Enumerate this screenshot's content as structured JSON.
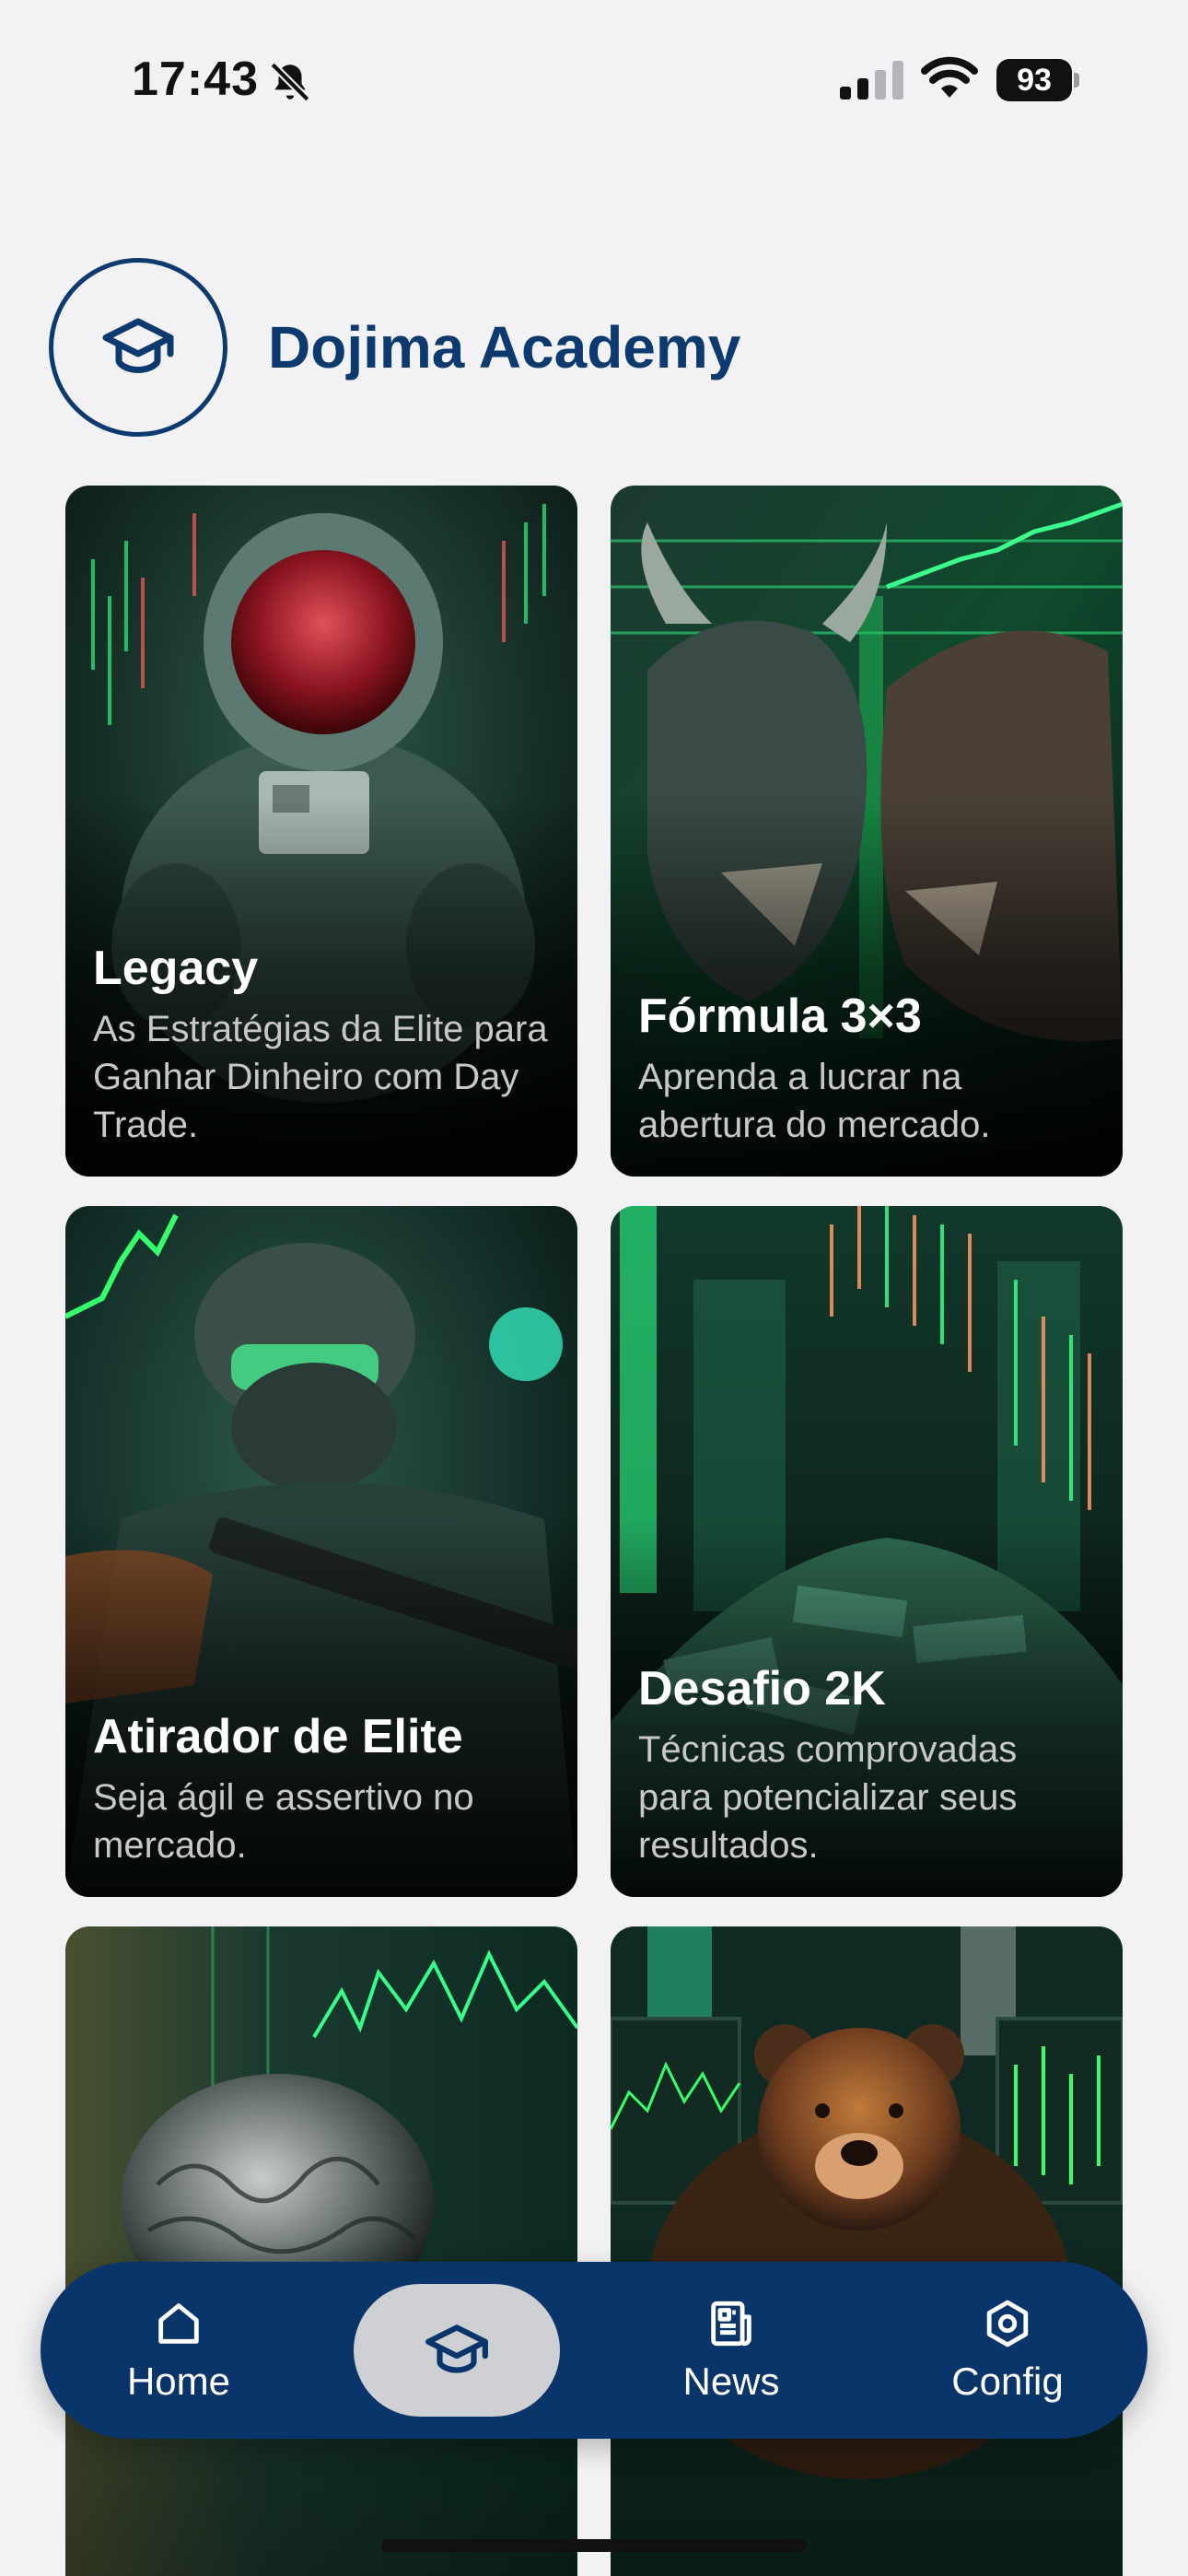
{
  "status_bar": {
    "time": "17:43",
    "battery": "93",
    "icons": [
      "bell-slash-icon",
      "signal-icon",
      "wifi-icon",
      "battery-icon"
    ]
  },
  "header": {
    "title": "Dojima Academy",
    "logo_icon": "graduation-cap-icon"
  },
  "courses": [
    {
      "title": "Legacy",
      "subtitle": "As Estratégias da Elite para Ganhar Dinheiro com Day Trade."
    },
    {
      "title": "Fórmula 3×3",
      "subtitle": "Aprenda a lucrar na abertura do mercado."
    },
    {
      "title": "Atirador de Elite",
      "subtitle": "Seja ágil e assertivo no mercado."
    },
    {
      "title": "Desafio 2K",
      "subtitle": "Técnicas comprovadas para potencializar seus resultados."
    },
    {
      "title": "",
      "subtitle": ""
    },
    {
      "title": "",
      "subtitle": ""
    }
  ],
  "tab_bar": {
    "tabs": [
      {
        "label": "Home",
        "icon": "home-icon"
      },
      {
        "label": "",
        "icon": "graduation-cap-icon",
        "active": true
      },
      {
        "label": "News",
        "icon": "newspaper-icon"
      },
      {
        "label": "Config",
        "icon": "settings-icon"
      }
    ]
  },
  "colors": {
    "brand": "#0d3a6e",
    "tab_bar": "#0a356a",
    "accent_green": "#1fd67a",
    "background": "#f2f2f4"
  }
}
